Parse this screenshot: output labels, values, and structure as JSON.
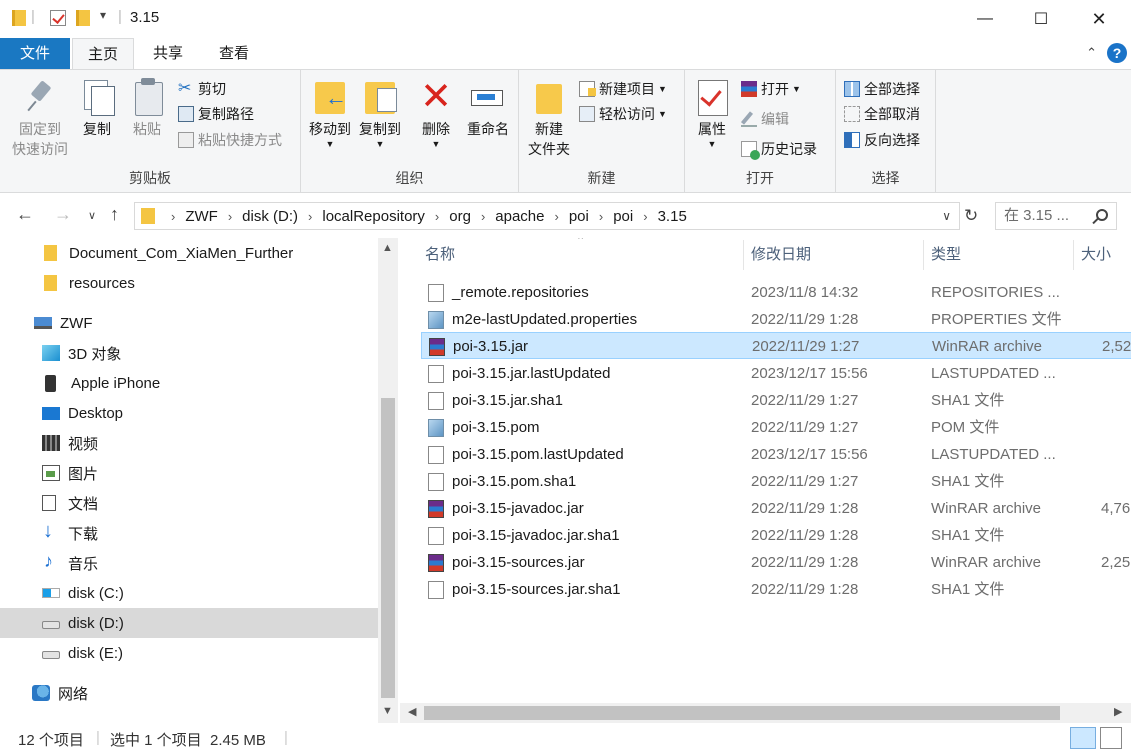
{
  "window": {
    "title": "3.15",
    "controls": {
      "minimize": "—",
      "maximize": "☐",
      "close": "✕"
    }
  },
  "ribbon_tabs": [
    "文件",
    "主页",
    "共享",
    "查看"
  ],
  "ribbon": {
    "clipboard": {
      "label": "剪贴板",
      "pin_line1": "固定到",
      "pin_line2": "快速访问",
      "copy": "复制",
      "paste": "粘贴",
      "cut": "剪切",
      "copy_path": "复制路径",
      "paste_shortcut": "粘贴快捷方式"
    },
    "organize": {
      "label": "组织",
      "move_to": "移动到",
      "copy_to": "复制到",
      "delete": "删除",
      "rename": "重命名"
    },
    "new": {
      "label": "新建",
      "new_folder_line1": "新建",
      "new_folder_line2": "文件夹",
      "new_item": "新建项目",
      "easy_access": "轻松访问"
    },
    "open": {
      "label": "打开",
      "properties": "属性",
      "open": "打开",
      "edit": "编辑",
      "history": "历史记录"
    },
    "select": {
      "label": "选择",
      "select_all": "全部选择",
      "select_none": "全部取消",
      "invert": "反向选择"
    }
  },
  "address": {
    "breadcrumbs": [
      "ZWF",
      "disk (D:)",
      "localRepository",
      "org",
      "apache",
      "poi",
      "poi",
      "3.15"
    ],
    "search_placeholder": "在 3.15 ..."
  },
  "nav_pane": {
    "items": [
      {
        "label": "Document_Com_XiaMen_Further",
        "icon": "folder-icon",
        "indent": 1
      },
      {
        "label": "resources",
        "icon": "folder-icon",
        "indent": 1
      },
      {
        "label": "ZWF",
        "icon": "this-pc-icon",
        "indent": 0
      },
      {
        "label": "3D 对象",
        "icon": "3d-objects-icon",
        "indent": 1
      },
      {
        "label": "Apple iPhone",
        "icon": "phone-icon",
        "indent": 1
      },
      {
        "label": "Desktop",
        "icon": "desktop-icon",
        "indent": 1
      },
      {
        "label": "视频",
        "icon": "video-icon",
        "indent": 1
      },
      {
        "label": "图片",
        "icon": "pictures-icon",
        "indent": 1
      },
      {
        "label": "文档",
        "icon": "documents-icon",
        "indent": 1
      },
      {
        "label": "下载",
        "icon": "downloads-icon",
        "indent": 1
      },
      {
        "label": "音乐",
        "icon": "music-icon",
        "indent": 1
      },
      {
        "label": "disk (C:)",
        "icon": "windows-drive-icon",
        "indent": 1
      },
      {
        "label": "disk (D:)",
        "icon": "drive-icon",
        "indent": 1,
        "selected": true
      },
      {
        "label": "disk (E:)",
        "icon": "drive-icon",
        "indent": 1
      },
      {
        "label": "网络",
        "icon": "network-icon",
        "indent": 0
      }
    ]
  },
  "file_list": {
    "columns": [
      "名称",
      "修改日期",
      "类型",
      "大小"
    ],
    "rows": [
      {
        "name": "_remote.repositories",
        "date": "2023/11/8 14:32",
        "type": "REPOSITORIES ...",
        "size": "",
        "icon": "generic-file-icon"
      },
      {
        "name": "m2e-lastUpdated.properties",
        "date": "2022/11/29 1:28",
        "type": "PROPERTIES 文件",
        "size": "",
        "icon": "properties-file-icon"
      },
      {
        "name": "poi-3.15.jar",
        "date": "2022/11/29 1:27",
        "type": "WinRAR archive",
        "size": "2,52",
        "icon": "winrar-icon",
        "selected": true
      },
      {
        "name": "poi-3.15.jar.lastUpdated",
        "date": "2023/12/17 15:56",
        "type": "LASTUPDATED ...",
        "size": "",
        "icon": "generic-file-icon"
      },
      {
        "name": "poi-3.15.jar.sha1",
        "date": "2022/11/29 1:27",
        "type": "SHA1 文件",
        "size": "",
        "icon": "generic-file-icon"
      },
      {
        "name": "poi-3.15.pom",
        "date": "2022/11/29 1:27",
        "type": "POM 文件",
        "size": "",
        "icon": "properties-file-icon"
      },
      {
        "name": "poi-3.15.pom.lastUpdated",
        "date": "2023/12/17 15:56",
        "type": "LASTUPDATED ...",
        "size": "",
        "icon": "generic-file-icon"
      },
      {
        "name": "poi-3.15.pom.sha1",
        "date": "2022/11/29 1:27",
        "type": "SHA1 文件",
        "size": "",
        "icon": "generic-file-icon"
      },
      {
        "name": "poi-3.15-javadoc.jar",
        "date": "2022/11/29 1:28",
        "type": "WinRAR archive",
        "size": "4,76",
        "icon": "winrar-icon"
      },
      {
        "name": "poi-3.15-javadoc.jar.sha1",
        "date": "2022/11/29 1:28",
        "type": "SHA1 文件",
        "size": "",
        "icon": "generic-file-icon"
      },
      {
        "name": "poi-3.15-sources.jar",
        "date": "2022/11/29 1:28",
        "type": "WinRAR archive",
        "size": "2,25",
        "icon": "winrar-icon"
      },
      {
        "name": "poi-3.15-sources.jar.sha1",
        "date": "2022/11/29 1:28",
        "type": "SHA1 文件",
        "size": "",
        "icon": "generic-file-icon"
      }
    ]
  },
  "status_bar": {
    "item_count": "12 个项目",
    "selection": "选中 1 个项目  2.45 MB"
  },
  "colors": {
    "accent": "#1a78c2",
    "selection_bg": "#cce8ff",
    "nav_selected_bg": "#d9d9d9"
  }
}
